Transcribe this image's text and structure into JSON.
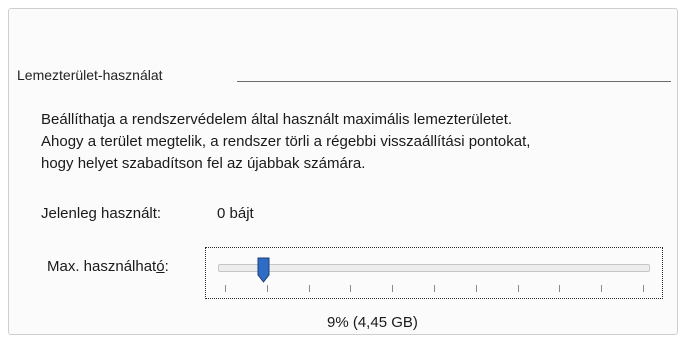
{
  "group": {
    "title": "Lemezterület-használat"
  },
  "description": {
    "line1": "Beállíthatja a rendszervédelem által használt maximális lemezterületet.",
    "line2": "Ahogy a terület megtelik, a rendszer törli a régebbi visszaállítási pontokat,",
    "line3": "hogy helyet szabadítson fel az újabbak számára."
  },
  "current_usage": {
    "label": "Jelenleg használt:",
    "value": "0 bájt"
  },
  "max_usage": {
    "label_prefix": "Max. használhat",
    "label_accel": "ó",
    "label_suffix": ":",
    "slider_value_percent": 9,
    "tick_count": 11,
    "value_text": "9% (4,45 GB)"
  },
  "colors": {
    "thumb_fill": "#2f6cc6",
    "thumb_border": "#1c3f7a",
    "legend_line": "#6b6b6b"
  }
}
